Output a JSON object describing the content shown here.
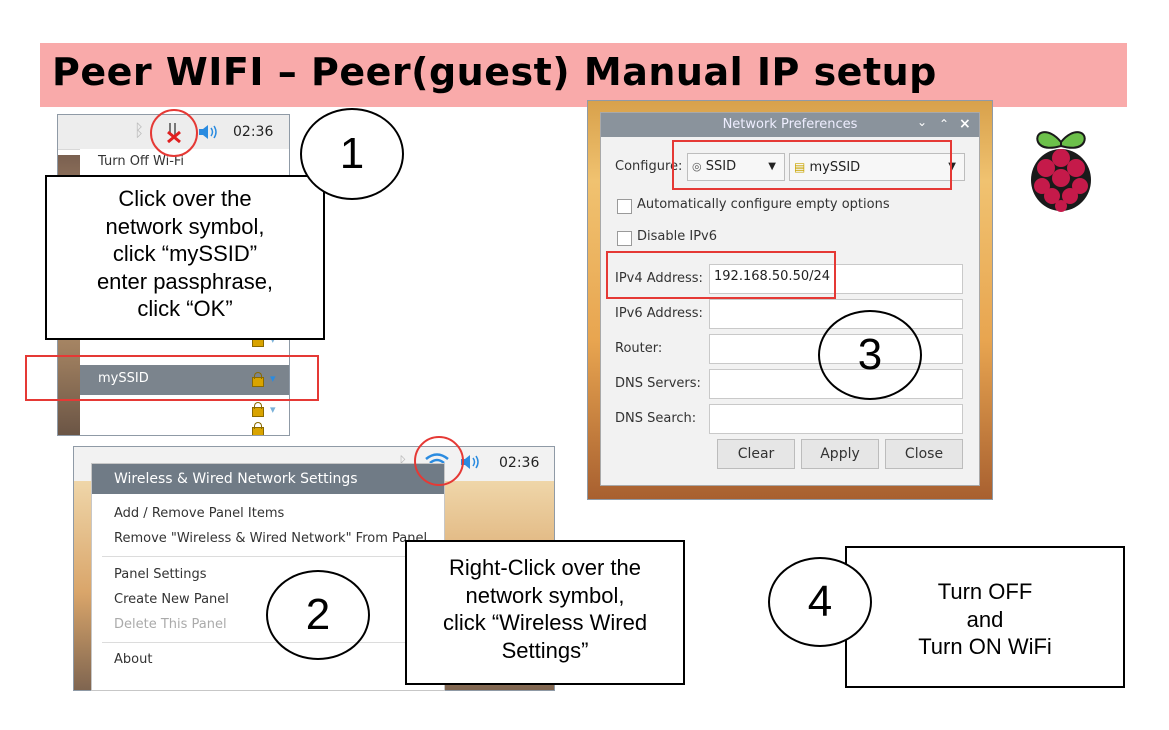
{
  "title": "Peer WIFI – Peer(guest) Manual IP setup",
  "step1": {
    "number": "1",
    "clock": "02:36",
    "menu_top": "Turn Off Wi-Fi",
    "selected_network": "mySSID",
    "callout": "Click over the\nnetwork symbol,\nclick “mySSID”\nenter passphrase,\nclick “OK”"
  },
  "step2": {
    "number": "2",
    "clock": "02:36",
    "menu_header": "Wireless & Wired Network Settings",
    "menu_items": [
      "Add / Remove Panel Items",
      "Remove \"Wireless & Wired Network\" From Panel",
      "Panel Settings",
      "Create New Panel",
      "Delete This Panel",
      "About"
    ],
    "callout": "Right-Click over the\nnetwork symbol,\nclick “Wireless Wired\nSettings”"
  },
  "step3": {
    "number": "3",
    "window_title": "Network Preferences",
    "window_controls": [
      "⌄",
      "⌃",
      "×"
    ],
    "configure_label": "Configure:",
    "configure_type": "SSID",
    "configure_value": "mySSID",
    "auto_configure_label": "Automatically configure empty options",
    "disable_ipv6_label": "Disable IPv6",
    "fields": [
      {
        "label": "IPv4 Address:",
        "value": "192.168.50.50/24"
      },
      {
        "label": "IPv6 Address:",
        "value": ""
      },
      {
        "label": "Router:",
        "value": ""
      },
      {
        "label": "DNS Servers:",
        "value": ""
      },
      {
        "label": "DNS Search:",
        "value": ""
      }
    ],
    "buttons": {
      "clear": "Clear",
      "apply": "Apply",
      "close": "Close"
    }
  },
  "step4": {
    "number": "4",
    "callout": "Turn OFF\nand\nTurn ON WiFi"
  },
  "colors": {
    "banner": "#f9aaaa",
    "highlight_red": "#e53935",
    "menu_header": "#707b86",
    "raspberry": "#c51a4a",
    "leaf": "#6cc04a"
  }
}
